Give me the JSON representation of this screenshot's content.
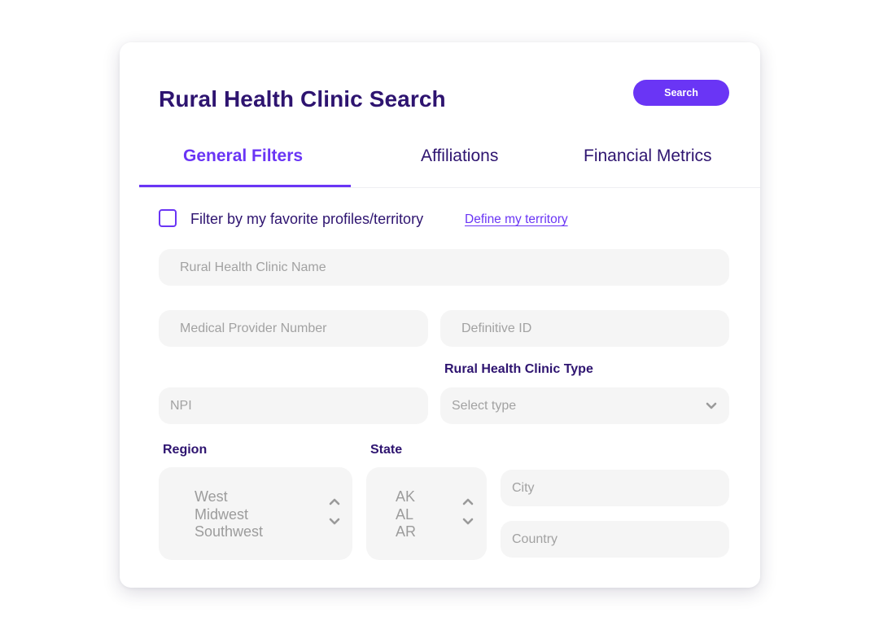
{
  "header": {
    "title": "Rural Health Clinic Search",
    "search_label": "Search"
  },
  "tabs": [
    {
      "label": "General Filters",
      "active": true
    },
    {
      "label": "Affiliations",
      "active": false
    },
    {
      "label": "Financial Metrics",
      "active": false
    }
  ],
  "filter": {
    "checkbox_label": "Filter by my favorite profiles/territory",
    "checked": false,
    "link_label": "Define my territory"
  },
  "fields": {
    "clinic_name_placeholder": "Rural Health Clinic Name",
    "provider_number_placeholder": "Medical Provider Number",
    "definitive_id_placeholder": "Definitive ID",
    "npi_placeholder": "NPI",
    "clinic_type_label": "Rural Health Clinic Type",
    "clinic_type_placeholder": "Select type",
    "city_placeholder": "City",
    "country_placeholder": "Country"
  },
  "region": {
    "label": "Region",
    "options": [
      "West",
      "Midwest",
      "Southwest"
    ]
  },
  "state": {
    "label": "State",
    "options": [
      "AK",
      "AL",
      "AR"
    ]
  },
  "icons": {
    "select_chevron": "chevron-down-icon",
    "stepper_up": "chevron-up-icon",
    "stepper_down": "chevron-down-icon"
  },
  "colors": {
    "accent": "#6a35f5",
    "heading": "#2e1470",
    "field_bg": "#f5f5f5",
    "placeholder": "#a2a2a2"
  }
}
